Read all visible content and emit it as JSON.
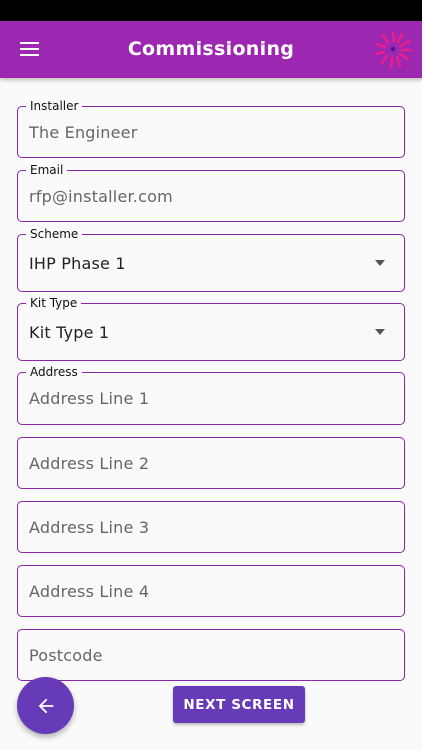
{
  "app_bar": {
    "title": "Commissioning"
  },
  "form": {
    "installer": {
      "label": "Installer",
      "value": "The Engineer"
    },
    "email": {
      "label": "Email",
      "value": "rfp@installer.com"
    },
    "scheme": {
      "label": "Scheme",
      "selected": "IHP Phase 1"
    },
    "kit_type": {
      "label": "Kit Type",
      "selected": "Kit Type 1"
    },
    "address": {
      "label": "Address",
      "line1_placeholder": "Address Line 1",
      "line2_placeholder": "Address Line 2",
      "line3_placeholder": "Address Line 3",
      "line4_placeholder": "Address Line 4",
      "postcode_placeholder": "Postcode"
    }
  },
  "actions": {
    "next_label": "NEXT SCREEN",
    "back_icon": "arrow-left-icon"
  },
  "colors": {
    "app_bar": "#9c27b0",
    "primary": "#673ab7",
    "field_border": "#8e24aa",
    "logo_accent": "#e91e8c"
  }
}
